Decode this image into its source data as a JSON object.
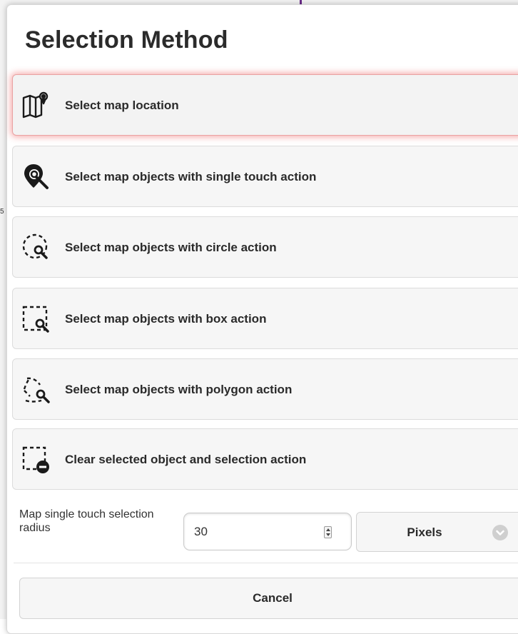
{
  "dialog": {
    "title": "Selection Method",
    "options": [
      {
        "label": "Select map location",
        "icon": "map-pin-icon",
        "active": true
      },
      {
        "label": "Select map objects with single touch action",
        "icon": "pin-search-icon"
      },
      {
        "label": "Select map objects with circle action",
        "icon": "circle-select-icon"
      },
      {
        "label": "Select map objects with box action",
        "icon": "box-select-icon"
      },
      {
        "label": "Select map objects with polygon action",
        "icon": "polygon-select-icon"
      },
      {
        "label": "Clear selected object and selection action",
        "icon": "clear-selection-icon"
      }
    ],
    "radius": {
      "label": "Map single touch selection radius",
      "value": "30",
      "unit": "Pixels",
      "unit_icon": "chevron-down-icon"
    },
    "cancel_label": "Cancel"
  },
  "colors": {
    "active_glow": "#eb4646",
    "button_bg": "#f6f6f6",
    "text": "#2a2a2a"
  }
}
